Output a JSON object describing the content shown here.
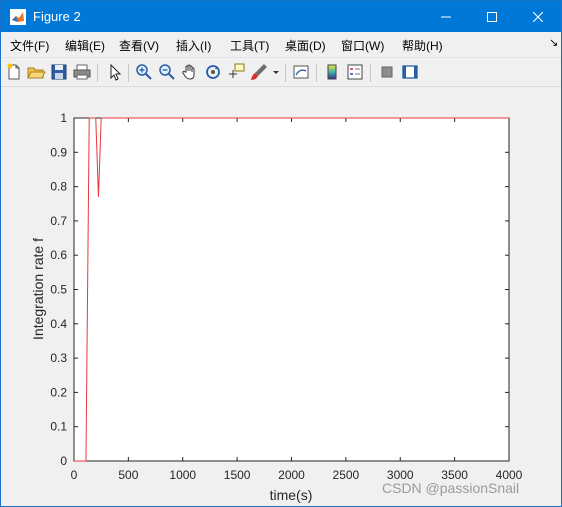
{
  "window": {
    "title": "Figure 2",
    "accent_color": "#0078d7"
  },
  "menubar": {
    "items": [
      "文件(F)",
      "编辑(E)",
      "查看(V)",
      "插入(I)",
      "工具(T)",
      "桌面(D)",
      "窗口(W)",
      "帮助(H)"
    ]
  },
  "toolbar": {
    "buttons": [
      "new-figure-icon",
      "open-file-icon",
      "save-icon",
      "print-icon",
      "pointer-icon",
      "zoom-in-icon",
      "zoom-out-icon",
      "pan-hand-icon",
      "rotate-3d-icon",
      "data-cursor-icon",
      "brush-icon",
      "link-plot-icon",
      "colorbar-icon",
      "legend-icon",
      "hide-plot-tools-icon",
      "show-plot-tools-icon"
    ]
  },
  "chart_data": {
    "type": "line",
    "xlabel": "time(s)",
    "ylabel": "Integration rate f",
    "xlim": [
      0,
      4000
    ],
    "ylim": [
      0,
      1
    ],
    "xticks": [
      0,
      500,
      1000,
      1500,
      2000,
      2500,
      3000,
      3500,
      4000
    ],
    "yticks": [
      0,
      0.1,
      0.2,
      0.3,
      0.4,
      0.5,
      0.6,
      0.7,
      0.8,
      0.9,
      1
    ],
    "grid": false,
    "line_color": "#e8383d",
    "series": [
      {
        "x": [
          0,
          110,
          140,
          200,
          225,
          250,
          4000
        ],
        "y": [
          0,
          0,
          1,
          1,
          0.77,
          1,
          1
        ]
      }
    ]
  },
  "watermark": "CSDN @passionSnail"
}
